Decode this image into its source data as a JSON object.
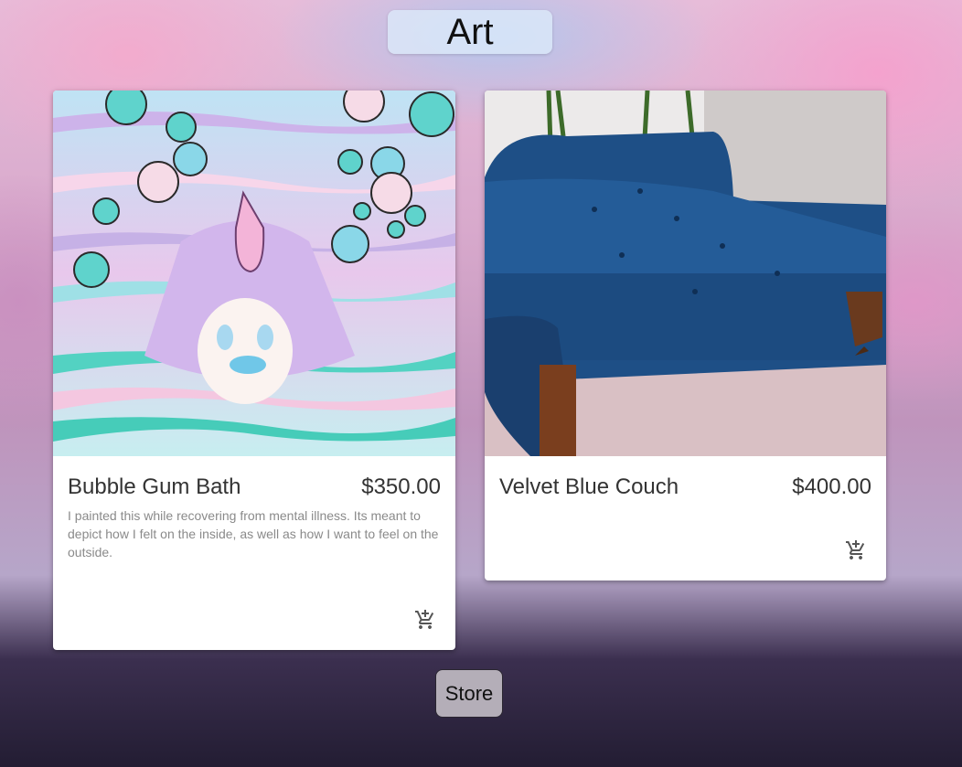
{
  "header": {
    "title": "Art"
  },
  "products": [
    {
      "title": "Bubble Gum Bath",
      "price": "$350.00",
      "description": "I painted this while recovering from mental illness. Its meant to depict how I felt on the inside, as well as how I want to feel on the outside.",
      "cart_icon": "add-shopping-cart-icon"
    },
    {
      "title": "Velvet Blue Couch",
      "price": "$400.00",
      "description": "",
      "cart_icon": "add-shopping-cart-icon"
    }
  ],
  "footer": {
    "store_label": "Store"
  },
  "colors": {
    "couch_blue": "#1f4a7a",
    "card_text": "#333333",
    "desc_text": "#8a8a8a"
  }
}
